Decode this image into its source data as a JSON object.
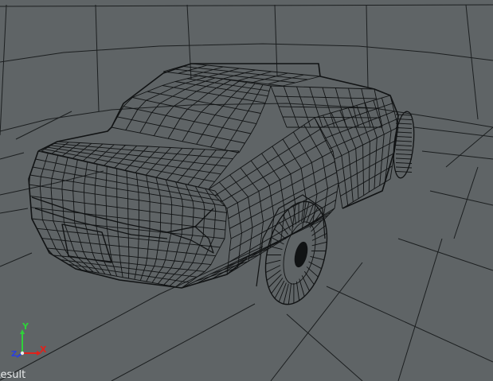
{
  "viewport": {
    "background": "#5f6466",
    "grid_color": "#1c1f20",
    "mesh_color": "#111314"
  },
  "axis_gizmo": {
    "y_label": "Y",
    "x_label": "X",
    "z_label": "Z",
    "y_color": "#2fd13a",
    "x_color": "#e0221b",
    "z_color": "#2a3fe0"
  },
  "status": {
    "label": "Result"
  }
}
